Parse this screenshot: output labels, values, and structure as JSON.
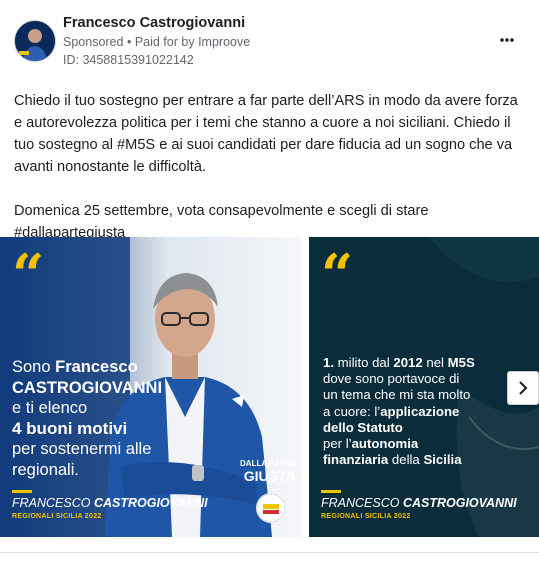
{
  "post": {
    "author": "Francesco Castrogiovanni",
    "sponsored": "Sponsored",
    "paid_for_prefix": "Paid for by",
    "paid_for_by": "Improove",
    "ad_id": "ID: 3458815391022142",
    "text_paragraph_1": "Chiedo il tuo sostegno per entrare a far parte dell’ARS in modo da avere forza e autorevolezza politica per i temi che stanno a cuore a noi siciliani. Chiedo il tuo sostegno al #M5S e ai suoi candidati per dare fiducia ad un sogno che va avanti nonostante le difficoltà.",
    "text_paragraph_2": "Domenica 25 settembre, vota consapevolmente e scegli di stare #dallapartegiusta",
    "ellipsis": "..."
  },
  "carousel": {
    "slides": [
      {
        "quote_mark": "“",
        "line1_a": "Sono ",
        "line1_b": "Francesco",
        "line2": "CASTROGIOVANNI",
        "line3": "e ti elenco",
        "line4": "4 buoni motivi",
        "line5": "per sostenermi alle",
        "line6": "regionali.",
        "sig_first": "FRANCESCO ",
        "sig_last": "CASTROGIOVANNI",
        "region": "REGIONALI SICILIA 2022",
        "badge_top": "DALLA PARTE",
        "badge_big": "GIUSTA"
      },
      {
        "quote_mark": "“",
        "l1_a": "1.",
        "l1_b": " milito dal ",
        "l1_c": "2012",
        "l1_d": " nel ",
        "l1_e": "M5S",
        "l2": "dove sono portavoce di",
        "l3": "un tema che mi sta molto",
        "l4_a": "a cuore: l’",
        "l4_b": "applicazione",
        "l5": "dello Statuto",
        "l6_a": "per l’",
        "l6_b": "autonomia",
        "l7_a": "finanziaria",
        "l7_b": " della ",
        "l7_c": "Sicilia",
        "sig_first": "FRANCESCO ",
        "sig_last": "CASTROGIOVANNI",
        "region": "REGIONALI SICILIA 2022"
      }
    ]
  },
  "colors": {
    "accent_yellow": "#f2c200",
    "brand_blue": "#1b4f94"
  },
  "icons": {
    "more": "more-options-icon",
    "next": "chevron-right-icon"
  }
}
